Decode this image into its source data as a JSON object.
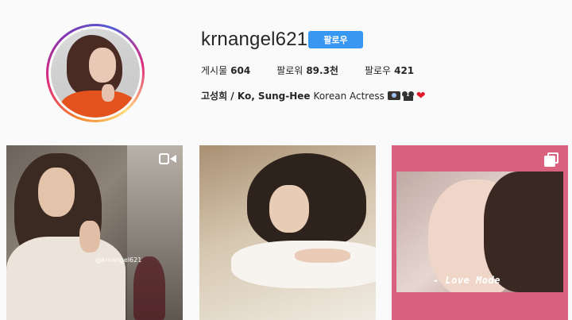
{
  "profile": {
    "username": "krnangel621",
    "follow_label": "팔로우",
    "stats": [
      {
        "label": "게시물",
        "value": "604"
      },
      {
        "label": "팔로워",
        "value": "89.3천"
      },
      {
        "label": "팔로우",
        "value": "421"
      }
    ],
    "bio_name": "고성희 / Ko, Sung-Hee",
    "bio_text": "Korean Actress",
    "bio_heart": "❤"
  },
  "posts": [
    {
      "type": "video",
      "caption": "@krnangel621"
    },
    {
      "type": "photo"
    },
    {
      "type": "multi",
      "caption": "- Love Mode"
    }
  ],
  "colors": {
    "follow_button": "#3897f0",
    "post3_frame": "#d9617e"
  },
  "icons": {
    "video": "video-camera-icon",
    "multi": "carousel-icon"
  }
}
